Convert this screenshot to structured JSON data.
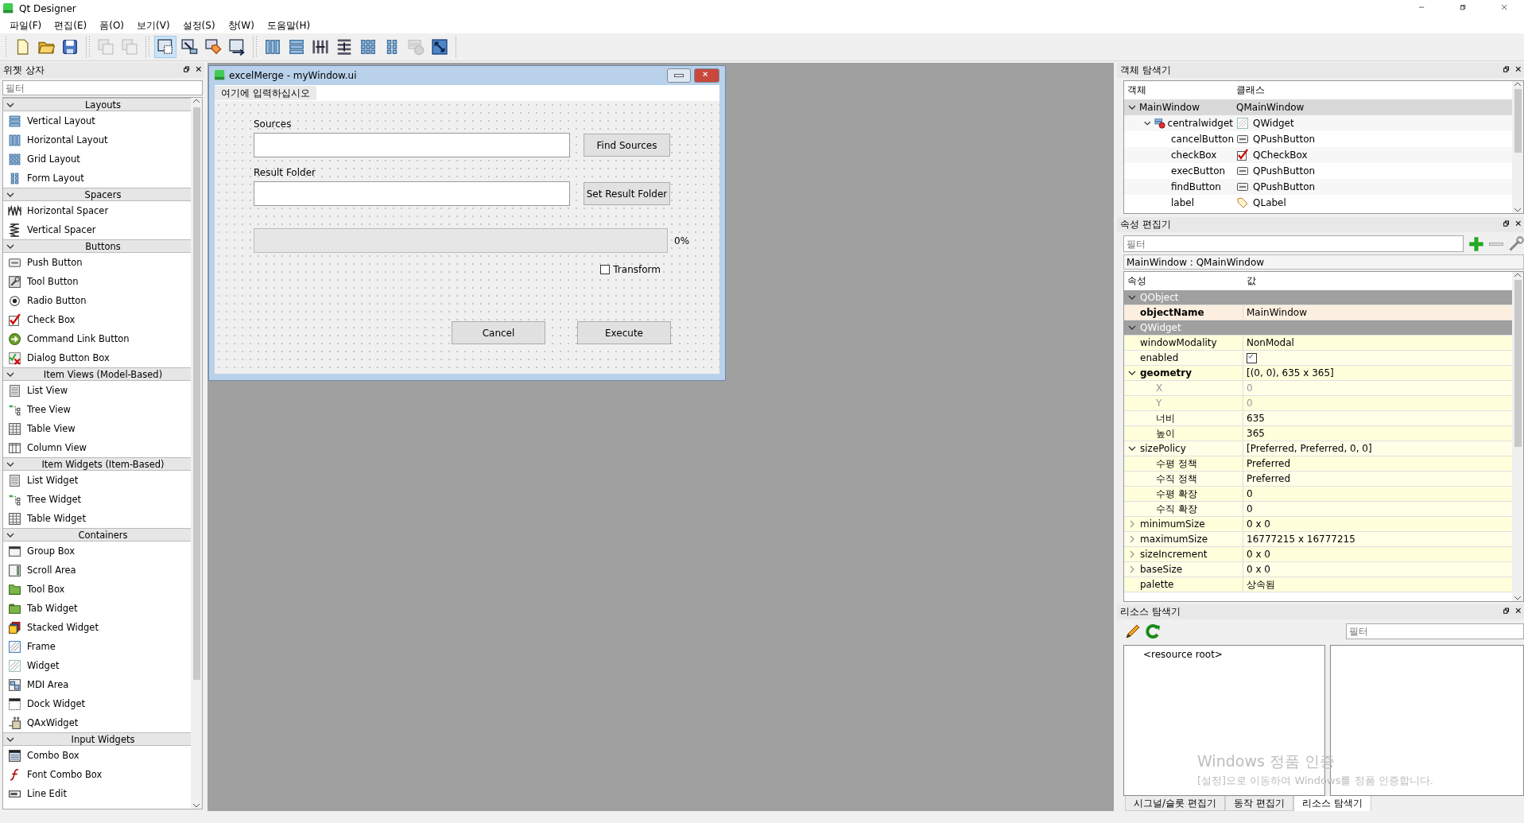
{
  "app": {
    "title": "Qt Designer"
  },
  "menu": [
    "파일(F)",
    "편집(E)",
    "폼(O)",
    "보기(V)",
    "설정(S)",
    "창(W)",
    "도움말(H)"
  ],
  "toolbar": [
    [
      {
        "kind": "new",
        "selected": false,
        "disabled": false
      },
      {
        "kind": "open",
        "selected": false,
        "disabled": false
      },
      {
        "kind": "save",
        "selected": false,
        "disabled": false
      }
    ],
    [
      {
        "kind": "dup",
        "selected": false,
        "disabled": true
      },
      {
        "kind": "dup",
        "selected": false,
        "disabled": true
      }
    ],
    [
      {
        "kind": "select",
        "selected": true,
        "disabled": false
      },
      {
        "kind": "signal",
        "selected": false,
        "disabled": false
      },
      {
        "kind": "tag",
        "selected": false,
        "disabled": false
      },
      {
        "kind": "taborder",
        "selected": false,
        "disabled": false
      }
    ],
    [
      {
        "kind": "columns",
        "selected": false,
        "disabled": false
      },
      {
        "kind": "rows",
        "selected": false,
        "disabled": false
      },
      {
        "kind": "hsplit",
        "selected": false,
        "disabled": false
      },
      {
        "kind": "vsplit",
        "selected": false,
        "disabled": false
      },
      {
        "kind": "grid",
        "selected": false,
        "disabled": false
      },
      {
        "kind": "form",
        "selected": false,
        "disabled": false
      },
      {
        "kind": "break",
        "selected": false,
        "disabled": true
      },
      {
        "kind": "adjust",
        "selected": false,
        "disabled": false
      }
    ]
  ],
  "widget_box": {
    "title": "위젯 상자",
    "filter": {
      "placeholder": "필터"
    },
    "categories": [
      {
        "name": "Layouts",
        "expanded": true,
        "items": [
          {
            "label": "Vertical Layout",
            "kind": "rows"
          },
          {
            "label": "Horizontal Layout",
            "kind": "columns"
          },
          {
            "label": "Grid Layout",
            "kind": "grid"
          },
          {
            "label": "Form Layout",
            "kind": "form"
          }
        ]
      },
      {
        "name": "Spacers",
        "expanded": true,
        "items": [
          {
            "label": "Horizontal Spacer",
            "kind": "hspring"
          },
          {
            "label": "Vertical Spacer",
            "kind": "vspring"
          }
        ]
      },
      {
        "name": "Buttons",
        "expanded": true,
        "items": [
          {
            "label": "Push Button",
            "kind": "push"
          },
          {
            "label": "Tool Button",
            "kind": "tool"
          },
          {
            "label": "Radio Button",
            "kind": "radio"
          },
          {
            "label": "Check Box",
            "kind": "check"
          },
          {
            "label": "Command Link Button",
            "kind": "cmdlink"
          },
          {
            "label": "Dialog Button Box",
            "kind": "dialog"
          }
        ]
      },
      {
        "name": "Item Views (Model-Based)",
        "expanded": true,
        "items": [
          {
            "label": "List View",
            "kind": "list"
          },
          {
            "label": "Tree View",
            "kind": "tree"
          },
          {
            "label": "Table View",
            "kind": "table"
          },
          {
            "label": "Column View",
            "kind": "colview"
          }
        ]
      },
      {
        "name": "Item Widgets (Item-Based)",
        "expanded": true,
        "items": [
          {
            "label": "List Widget",
            "kind": "list"
          },
          {
            "label": "Tree Widget",
            "kind": "tree"
          },
          {
            "label": "Table Widget",
            "kind": "table"
          }
        ]
      },
      {
        "name": "Containers",
        "expanded": true,
        "items": [
          {
            "label": "Group Box",
            "kind": "group"
          },
          {
            "label": "Scroll Area",
            "kind": "scroll"
          },
          {
            "label": "Tool Box",
            "kind": "toolbox"
          },
          {
            "label": "Tab Widget",
            "kind": "tab"
          },
          {
            "label": "Stacked Widget",
            "kind": "stack"
          },
          {
            "label": "Frame",
            "kind": "frame"
          },
          {
            "label": "Widget",
            "kind": "widget"
          },
          {
            "label": "MDI Area",
            "kind": "mdi"
          },
          {
            "label": "Dock Widget",
            "kind": "dock"
          },
          {
            "label": "QAxWidget",
            "kind": "ax"
          }
        ]
      },
      {
        "name": "Input Widgets",
        "expanded": true,
        "items": [
          {
            "label": "Combo Box",
            "kind": "combo"
          },
          {
            "label": "Font Combo Box",
            "kind": "font"
          },
          {
            "label": "Line Edit",
            "kind": "lineedit"
          }
        ]
      }
    ]
  },
  "form_window": {
    "title": "excelMerge - myWindow.ui",
    "menu_placeholder": "여기에 입력하십시오",
    "fields": [
      {
        "label": "Sources",
        "button": "Find Sources"
      },
      {
        "label": "Result Folder",
        "button": "Set Result Folder"
      }
    ],
    "progress": {
      "level": 0,
      "reading": "0%"
    },
    "checkbox": {
      "label": "Transform",
      "checked": false
    },
    "buttons": [
      "Cancel",
      "Execute"
    ]
  },
  "object_inspector": {
    "title": "객체 탐색기",
    "columns": [
      "객체",
      "클래스"
    ],
    "tree": [
      {
        "name": "MainWindow",
        "class": "QMainWindow",
        "expanded": true,
        "selected": true,
        "children": [
          {
            "name": "centralwidget",
            "class": "QWidget",
            "kind": "widget",
            "expanded": true,
            "selected": false,
            "children": [
              {
                "name": "cancelButton",
                "class": "QPushButton",
                "kind": "button",
                "selected": false
              },
              {
                "name": "checkBox",
                "class": "QCheckBox",
                "kind": "checkbox",
                "selected": false
              },
              {
                "name": "execButton",
                "class": "QPushButton",
                "kind": "button",
                "selected": false
              },
              {
                "name": "findButton",
                "class": "QPushButton",
                "kind": "button",
                "selected": false
              },
              {
                "name": "label",
                "class": "QLabel",
                "kind": "label",
                "selected": false
              }
            ]
          }
        ]
      }
    ]
  },
  "property_editor": {
    "title": "속성 편집기",
    "filter": {
      "placeholder": "필터"
    },
    "object_label": "MainWindow : QMainWindow",
    "columns": [
      "속성",
      "값"
    ],
    "rows": [
      {
        "kind": "group",
        "name": "QObject",
        "expanded": true
      },
      {
        "kind": "text",
        "name": "objectName",
        "value": "MainWindow",
        "modified": true
      },
      {
        "kind": "group",
        "name": "QWidget",
        "expanded": true
      },
      {
        "kind": "text",
        "name": "windowModality",
        "value": "NonModal",
        "modified": false
      },
      {
        "kind": "checkbox",
        "name": "enabled",
        "checked": true,
        "modified": false
      },
      {
        "kind": "text",
        "name": "geometry",
        "value": "[(0, 0), 635 x 365]",
        "modified": true,
        "expanded": true,
        "children": [
          {
            "kind": "text",
            "name": "X",
            "value": "0",
            "disabled": true
          },
          {
            "kind": "text",
            "name": "Y",
            "value": "0",
            "disabled": true
          },
          {
            "kind": "text",
            "name": "너비",
            "value": "635",
            "disabled": false
          },
          {
            "kind": "text",
            "name": "높이",
            "value": "365",
            "disabled": false
          }
        ]
      },
      {
        "kind": "text",
        "name": "sizePolicy",
        "value": "[Preferred, Preferred, 0, 0]",
        "modified": false,
        "expanded": true,
        "children": [
          {
            "kind": "text",
            "name": "수평 정책",
            "value": "Preferred",
            "disabled": false
          },
          {
            "kind": "text",
            "name": "수직 정책",
            "value": "Preferred",
            "disabled": false
          },
          {
            "kind": "text",
            "name": "수평 확장",
            "value": "0",
            "disabled": false
          },
          {
            "kind": "text",
            "name": "수직 확장",
            "value": "0",
            "disabled": false
          }
        ]
      },
      {
        "kind": "text",
        "name": "minimumSize",
        "value": "0 x 0",
        "modified": false,
        "expanded": false
      },
      {
        "kind": "text",
        "name": "maximumSize",
        "value": "16777215 x 16777215",
        "modified": false,
        "expanded": false
      },
      {
        "kind": "text",
        "name": "sizeIncrement",
        "value": "0 x 0",
        "modified": false,
        "expanded": false
      },
      {
        "kind": "text",
        "name": "baseSize",
        "value": "0 x 0",
        "modified": false,
        "expanded": false
      },
      {
        "kind": "text",
        "name": "palette",
        "value": "상속됨",
        "modified": false
      }
    ]
  },
  "resource_browser": {
    "title": "리소스 탐색기",
    "filter": {
      "placeholder": "필터"
    },
    "root": "<resource root>"
  },
  "bottom_tabs": [
    {
      "label": "시그널/슬롯 편집기",
      "selected": false
    },
    {
      "label": "동작 편집기",
      "selected": false
    },
    {
      "label": "리소스 탐색기",
      "selected": true
    }
  ],
  "activation_notice": {
    "title": "Windows 정품 인증",
    "text": "[설정]으로 이동하여 Windows를 정품 인증합니다."
  }
}
